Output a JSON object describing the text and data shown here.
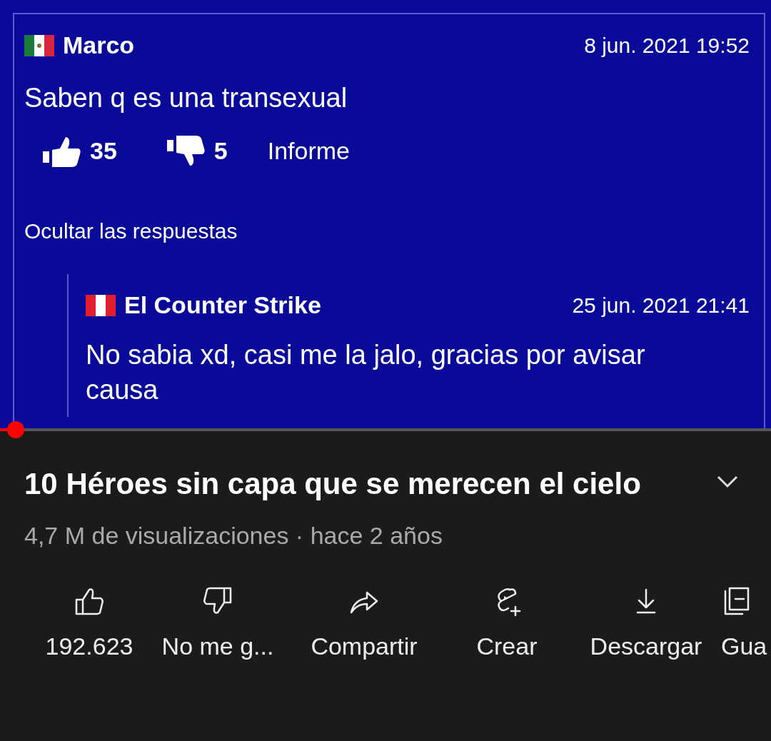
{
  "video_frame": {
    "comment": {
      "kind": "mexico",
      "author": "Marco",
      "date": "8 jun. 2021 19:52",
      "text": "Saben q es una transexual",
      "likes": "35",
      "dislikes": "5",
      "report": "Informe",
      "toggle": "Ocultar las respuestas"
    },
    "reply": {
      "kind": "peru",
      "author": "El Counter Strike",
      "date": "25 jun. 2021 21:41",
      "text": "No sabia xd, casi me la jalo, gracias por avisar causa"
    }
  },
  "progress": {
    "level": 0.02
  },
  "title": "10 Héroes sin capa que se merecen el cielo",
  "meta": "4,7 M de visualizaciones · hace 2 años",
  "actions": [
    {
      "kind": "like",
      "label": "192.623"
    },
    {
      "kind": "dislike",
      "label": "No me g..."
    },
    {
      "kind": "share",
      "label": "Compartir"
    },
    {
      "kind": "create",
      "label": "Crear"
    },
    {
      "kind": "download",
      "label": "Descargar"
    },
    {
      "kind": "save",
      "label": "Gua"
    }
  ]
}
